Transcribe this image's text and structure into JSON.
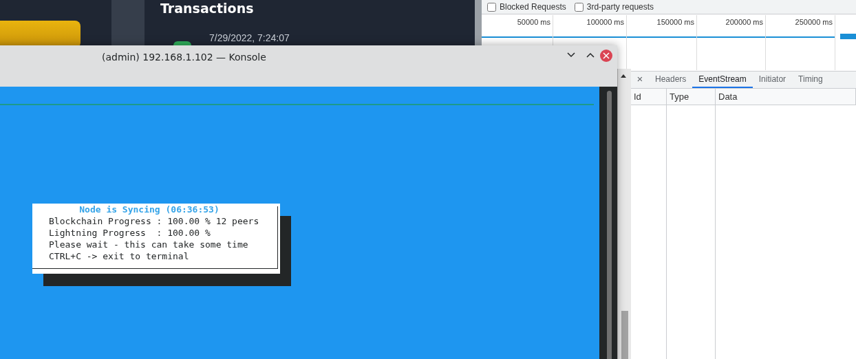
{
  "background_app": {
    "heading": "Transactions",
    "transaction_time": "7/29/2022, 7:24:07"
  },
  "devtools": {
    "filters": [
      {
        "label": "Blocked Requests",
        "checked": false
      },
      {
        "label": "3rd-party requests",
        "checked": false
      }
    ],
    "timeline_ticks": [
      "50000 ms",
      "100000 ms",
      "150000 ms",
      "200000 ms",
      "250000 ms"
    ],
    "close_glyph": "×",
    "detail_tabs": [
      {
        "label": "Headers",
        "selected": false
      },
      {
        "label": "EventStream",
        "selected": true
      },
      {
        "label": "Initiator",
        "selected": false
      },
      {
        "label": "Timing",
        "selected": false
      }
    ],
    "columns": [
      "Id",
      "Type",
      "Data"
    ]
  },
  "konsole": {
    "title": "(admin) 192.168.1.102 — Konsole",
    "dialog": {
      "title": "Node is Syncing (06:36:53)",
      "lines": [
        "Blockchain Progress : 100.00 % 12 peers",
        "Lightning Progress  : 100.00 %",
        "Please wait - this can take some time",
        "CTRL+C -> exit to terminal"
      ]
    }
  }
}
